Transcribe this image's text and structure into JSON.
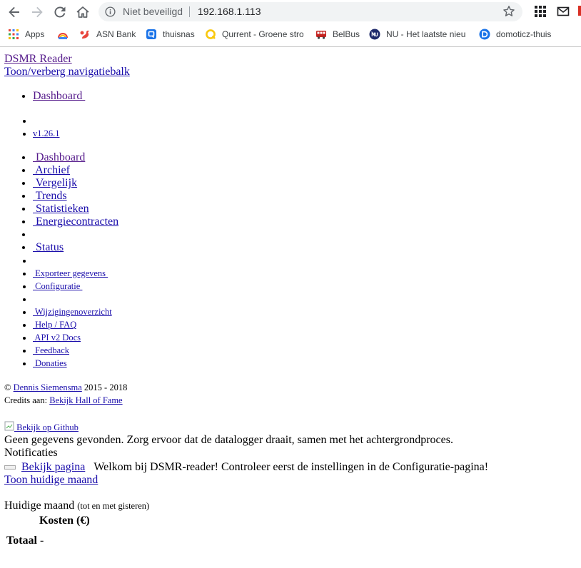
{
  "browser": {
    "security_label": "Niet beveiligd",
    "url": "192.168.1.113",
    "bookmarks": [
      {
        "label": "Apps",
        "icon": "apps-grid-icon",
        "color": "#e8453c"
      },
      {
        "label": "",
        "icon": "rainbow-icon",
        "color": "#f4b400"
      },
      {
        "label": "ASN Bank",
        "icon": "asn-squirrel-icon",
        "color": "#e8453c"
      },
      {
        "label": "thuisnas",
        "icon": "qnap-icon",
        "color": "#1a73e8"
      },
      {
        "label": "Qurrent - Groene stro",
        "icon": "qurrent-icon",
        "color": "#f9c80e"
      },
      {
        "label": "BelBus",
        "icon": "belbus-icon",
        "color": "#c5221f"
      },
      {
        "label": "NU - Het laatste nieu",
        "icon": "nu-icon",
        "color": "#1f2a6b"
      },
      {
        "label": "domoticz-thuis",
        "icon": "domoticz-icon",
        "color": "#1a73e8"
      }
    ]
  },
  "header": {
    "brand": "DSMR Reader",
    "toggle_nav": "Toon/verberg navigatiebalk"
  },
  "nav_top": {
    "dashboard": "Dashboard ",
    "version": "v1.26.1"
  },
  "nav_main": [
    {
      "label": " Dashboard",
      "visited": true
    },
    {
      "label": " Archief",
      "visited": false
    },
    {
      "label": " Vergelijk",
      "visited": false
    },
    {
      "label": " Trends",
      "visited": false
    },
    {
      "label": " Statistieken",
      "visited": false
    },
    {
      "label": " Energiecontracten",
      "visited": false
    }
  ],
  "nav_status": " Status",
  "nav_export": " Exporteer gegevens ",
  "nav_config": " Configuratie ",
  "nav_help": [
    " Wijzigingenoverzicht",
    " Help / FAQ",
    " API v2 Docs",
    " Feedback",
    " Donaties"
  ],
  "footer": {
    "copyright_symbol": "©",
    "author": "Dennis Siemensma",
    "years": " 2015 - 2018",
    "credits_label": "Credits aan: ",
    "hall_of_fame": "Bekijk Hall of Fame"
  },
  "github_link": " Bekijk op Github",
  "no_data_message": "Geen gegevens gevonden. Zorg ervoor dat de datalogger draait, samen met het achtergrondproces.",
  "notifications": {
    "title": "Notificaties",
    "view_page": "Bekijk pagina",
    "message": "Welkom bij DSMR-reader! Controleer eerst de instellingen in de Configuratie-pagina!"
  },
  "show_month": "Toon huidige maand",
  "current_month": {
    "title": "Huidige maand",
    "subtitle": "(tot en met gisteren)",
    "cost_header": "Kosten (€)",
    "total_label": "Totaal",
    "total_value": "-"
  },
  "colors": {
    "link": "#1a0dab",
    "visited_link": "#551a8b",
    "omnibox_bg": "#f1f3f4"
  }
}
